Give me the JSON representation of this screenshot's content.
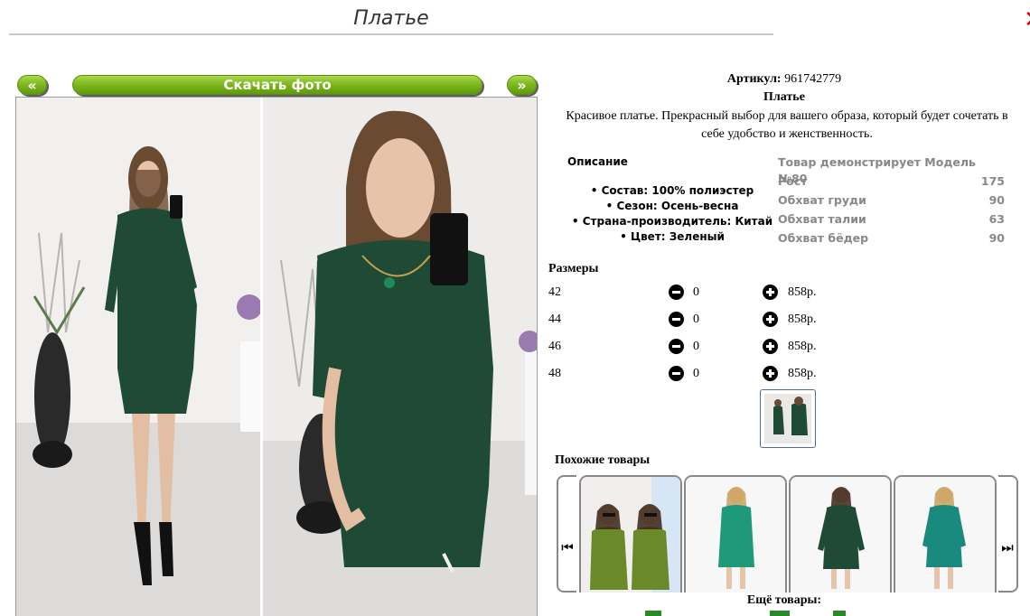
{
  "page": {
    "title": "Платье"
  },
  "gallery": {
    "prev_label": "«",
    "next_label": "»",
    "download_label": "Скачать фото"
  },
  "product": {
    "article_label": "Артикул:",
    "article_value": "961742779",
    "name": "Платье",
    "description": "Красивое платье. Прекрасный выбор для вашего образа, который будет сочетать в себе удобство и женственность."
  },
  "details": {
    "heading": "Описание",
    "items": [
      "Состав: 100% полиэстер",
      "Сезон: Осень-весна",
      "Страна-производитель: Китай",
      "Цвет: Зеленый"
    ]
  },
  "model": {
    "rows": [
      {
        "label": "Товар демонстрирует Модель №80",
        "value": ""
      },
      {
        "label": "Рост",
        "value": "175"
      },
      {
        "label": "Обхват груди",
        "value": "90"
      },
      {
        "label": "Обхват талии",
        "value": "63"
      },
      {
        "label": "Обхват бёдер",
        "value": "90"
      }
    ]
  },
  "sizes": {
    "heading": "Размеры",
    "rows": [
      {
        "size": "42",
        "qty": "0",
        "price": "858р."
      },
      {
        "size": "44",
        "qty": "0",
        "price": "858р."
      },
      {
        "size": "46",
        "qty": "0",
        "price": "858р."
      },
      {
        "size": "48",
        "qty": "0",
        "price": "858р."
      }
    ]
  },
  "similar": {
    "heading": "Похожие товары",
    "left_arrow": "⏮",
    "right_arrow": "⏭"
  },
  "more": {
    "heading": "Ещё товары:"
  },
  "colors": {
    "dress_green": "#1f4a36",
    "button_green": "#7fb81f",
    "icon_black": "#000000",
    "muted_text": "#888888"
  }
}
